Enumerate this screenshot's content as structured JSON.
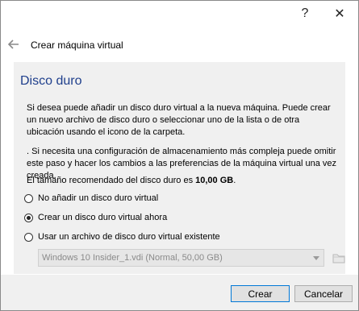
{
  "titlebar": {
    "help_label": "?",
    "close_label": "✕"
  },
  "wizard": {
    "title": "Crear máquina virtual"
  },
  "section": {
    "title": "Disco duro"
  },
  "text": {
    "p1": "Si desea puede añadir un disco duro virtual a la nueva máquina. Puede crear un nuevo archivo de disco duro o seleccionar uno de la lista o de otra ubicación usando el icono de la carpeta.",
    "p2": ". Si necesita una configuración de almacenamiento más compleja puede omitir este paso y hacer los cambios a las preferencias de la máquina virtual una vez creada.",
    "recommended_prefix": "El tamaño recomendado del disco duro es ",
    "recommended_size": "10,00 GB",
    "recommended_suffix": "."
  },
  "options": [
    {
      "label": "No añadir un disco duro virtual",
      "checked": false
    },
    {
      "label": "Crear un disco duro virtual ahora",
      "checked": true
    },
    {
      "label": "Usar un archivo de disco duro virtual existente",
      "checked": false
    }
  ],
  "disk_select": {
    "value": "Windows 10 Insider_1.vdi (Normal, 50,00 GB)"
  },
  "buttons": {
    "create": "Crear",
    "cancel": "Cancelar"
  },
  "colors": {
    "section_title": "#1f3f8c",
    "primary_border": "#0078d7"
  }
}
